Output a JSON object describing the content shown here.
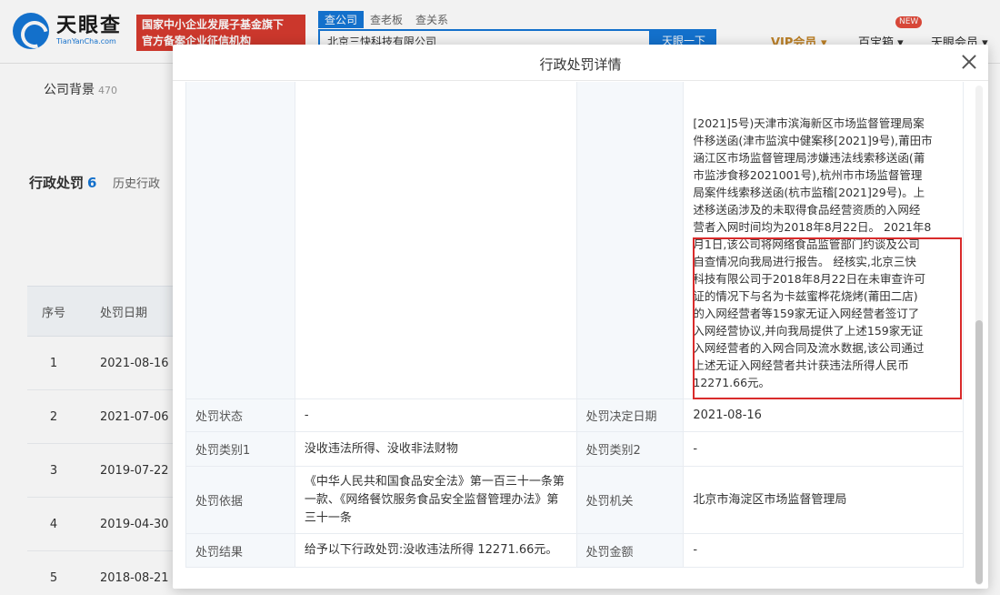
{
  "site": {
    "logo_name": "天眼查",
    "logo_domain": "TianYanCha.com",
    "promo": "国家中小企业发展子基金旗下\n官方备案企业征信机构",
    "search_tabs": [
      "查公司",
      "查老板",
      "查关系"
    ],
    "search_value": "北京三快科技有限公司",
    "search_button": "天眼一下",
    "vip_label": "VIP会员",
    "nav": [
      "百宝箱",
      "天眼会员"
    ],
    "nav_badge": "NEW"
  },
  "background": {
    "company_bg_label": "公司背景",
    "company_bg_count": "470",
    "section_title": "行政处罚",
    "section_count": "6",
    "section_tab2": "历史行政",
    "table_headers": [
      "序号",
      "处罚日期"
    ],
    "rows": [
      {
        "no": "1",
        "date": "2021-08-16"
      },
      {
        "no": "2",
        "date": "2021-07-06"
      },
      {
        "no": "3",
        "date": "2019-07-22"
      },
      {
        "no": "4",
        "date": "2019-04-30"
      },
      {
        "no": "5",
        "date": "2018-08-21"
      }
    ]
  },
  "modal": {
    "title": "行政处罚详情",
    "content_lines": [
      "[2021]5号)天津市滨海新区市场监督管理局案",
      "件移送函(津市监滨中健案移[2021]9号),莆田市",
      "涵江区市场监督管理局涉嫌违法线索移送函(莆",
      "市监涉食移2021001号),杭州市市场监督管理",
      "局案件线索移送函(杭市监稽[2021]29号)。上",
      "述移送函涉及的未取得食品经营资质的入网经",
      "营者入网时间均为2018年8月22日。 2021年8",
      "月1日,该公司将网络食品监管部门约谈及公司",
      "自查情况向我局进行报告。 经核实,北京三快",
      "科技有限公司于2018年8月22日在未审查许可",
      "证的情况下与名为卡兹蜜桦花烧烤(莆田二店)",
      "的入网经营者等159家无证入网经营者签订了",
      "入网经营协议,并向我局提供了上述159家无证",
      "入网经营者的入网合同及流水数据,该公司通过",
      "上述无证入网经营者共计获违法所得人民币",
      "12271.66元。"
    ],
    "fields": {
      "status_label": "处罚状态",
      "status_value": "-",
      "decision_date_label": "处罚决定日期",
      "decision_date_value": "2021-08-16",
      "type1_label": "处罚类别1",
      "type1_value": "没收违法所得、没收非法财物",
      "type2_label": "处罚类别2",
      "type2_value": "-",
      "basis_label": "处罚依据",
      "basis_value": "《中华人民共和国食品安全法》第一百三十一条第一款、《网络餐饮服务食品安全监督管理办法》第三十一条",
      "authority_label": "处罚机关",
      "authority_value": "北京市海淀区市场监督管理局",
      "result_label": "处罚结果",
      "result_value": "给予以下行政处罚:没收违法所得 12271.66元。",
      "amount_label": "处罚金额",
      "amount_value": "-"
    }
  },
  "colors": {
    "brand_blue": "#1576d6",
    "promo_red": "#d63a2f",
    "highlight_red": "#d92b2b",
    "vip_gold": "#c4862a"
  }
}
